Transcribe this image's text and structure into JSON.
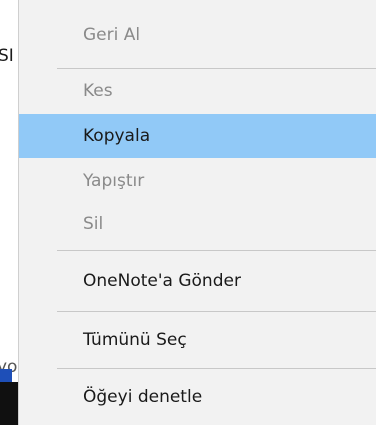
{
  "background": {
    "left_fragment_top": "SI",
    "left_fragment_bottom": "yo"
  },
  "menu": {
    "items": [
      {
        "label": "Geri Al",
        "enabled": false,
        "highlighted": false
      },
      {
        "label": "Kes",
        "enabled": false,
        "highlighted": false
      },
      {
        "label": "Kopyala",
        "enabled": true,
        "highlighted": true
      },
      {
        "label": "Yapıştır",
        "enabled": false,
        "highlighted": false
      },
      {
        "label": "Sil",
        "enabled": false,
        "highlighted": false
      },
      {
        "label": "OneNote'a Gönder",
        "enabled": true,
        "highlighted": false
      },
      {
        "label": "Tümünü Seç",
        "enabled": true,
        "highlighted": false
      },
      {
        "label": "Öğeyi denetle",
        "enabled": true,
        "highlighted": false
      }
    ],
    "highlight_color": "#91c9f7",
    "background_color": "#f2f2f2",
    "disabled_text_color": "#8a8a8a"
  }
}
